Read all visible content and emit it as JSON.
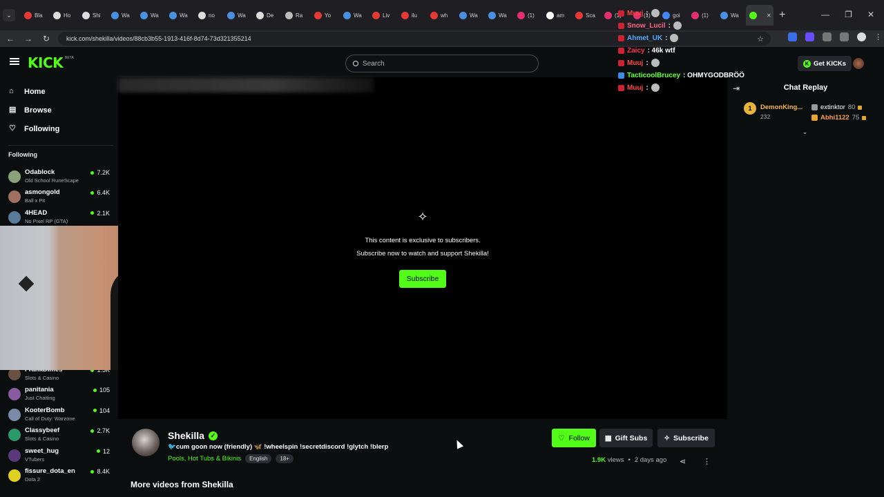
{
  "browser": {
    "tabs": [
      {
        "label": "Bla",
        "color": "#e53935"
      },
      {
        "label": "Ho",
        "color": "#dddddd"
      },
      {
        "label": "Shi",
        "color": "#dddddd"
      },
      {
        "label": "Wa",
        "color": "#4a90e2"
      },
      {
        "label": "Wa",
        "color": "#4a90e2"
      },
      {
        "label": "Wa",
        "color": "#4a90e2"
      },
      {
        "label": "no",
        "color": "#dddddd"
      },
      {
        "label": "Wa",
        "color": "#4a90e2"
      },
      {
        "label": "De",
        "color": "#dddddd"
      },
      {
        "label": "Ra",
        "color": "#bbbbbb"
      },
      {
        "label": "Yo",
        "color": "#e53935"
      },
      {
        "label": "Wa",
        "color": "#4a90e2"
      },
      {
        "label": "Liv",
        "color": "#e53935"
      },
      {
        "label": "ilu",
        "color": "#e53935"
      },
      {
        "label": "wh",
        "color": "#e53935"
      },
      {
        "label": "Wa",
        "color": "#4a90e2"
      },
      {
        "label": "Wa",
        "color": "#4a90e2"
      },
      {
        "label": "(1)",
        "color": "#e1306c"
      },
      {
        "label": "am",
        "color": "#ffffff"
      },
      {
        "label": "Sca",
        "color": "#e53935"
      },
      {
        "label": "(1)",
        "color": "#e1306c"
      },
      {
        "label": "(1)",
        "color": "#e1306c"
      },
      {
        "label": "goi",
        "color": "#4285f4"
      },
      {
        "label": "(1)",
        "color": "#e1306c"
      },
      {
        "label": "Wa",
        "color": "#4a90e2"
      },
      {
        "label": "",
        "color": "#53fc18",
        "active": true
      }
    ],
    "url": "kick.com/shekilla/videos/88cb3b55-1913-416f-8d74-73d321355214"
  },
  "header": {
    "logo": "KICK",
    "beta": "BETA",
    "search_placeholder": "Search",
    "get_kicks": "Get KICKs"
  },
  "sidebar": {
    "nav": [
      {
        "label": "Home",
        "icon": "home-icon"
      },
      {
        "label": "Browse",
        "icon": "browse-icon"
      },
      {
        "label": "Following",
        "icon": "heart-icon"
      }
    ],
    "following_heading": "Following",
    "channels_top": [
      {
        "name": "Odablock",
        "game": "Old School RuneScape",
        "viewers": "7.2K",
        "color": "#8aa27a"
      },
      {
        "name": "asmongold",
        "game": "Ball x Pit",
        "viewers": "6.4K",
        "color": "#a07060"
      },
      {
        "name": "4HEAD",
        "game": "No Pixel RP (GTA)",
        "viewers": "2.1K",
        "color": "#5a7a9a"
      }
    ],
    "channels_bottom": [
      {
        "name": "FrankDimes",
        "game": "Slots & Casino",
        "viewers": "1.5K",
        "color": "#6a5040"
      },
      {
        "name": "panitania",
        "game": "Just Chatting",
        "viewers": "105",
        "color": "#8a5aa0"
      },
      {
        "name": "KooterBomb",
        "game": "Call of Duty: Warzone",
        "viewers": "104",
        "color": "#7a8aa8"
      },
      {
        "name": "Classybeef",
        "game": "Slots & Casino",
        "viewers": "2.7K",
        "color": "#2a9a6a"
      },
      {
        "name": "sweet_hug",
        "game": "VTubers",
        "viewers": "12",
        "color": "#5a3a7a"
      },
      {
        "name": "fissure_dota_en",
        "game": "Dota 2",
        "viewers": "8.4K",
        "color": "#e0d020"
      }
    ]
  },
  "player": {
    "exclusive_line1": "This content is exclusive to subscribers.",
    "exclusive_line2": "Subscribe now to watch and support Shekilla!",
    "subscribe_label": "Subscribe"
  },
  "chat": {
    "title": "Chat Replay",
    "leaderboard": {
      "rank": "1",
      "top_name": "DemonKing...",
      "top_value": "232",
      "others": [
        {
          "name": "extinktor",
          "value": "80",
          "color": "#ffffff"
        },
        {
          "name": "Abhi1122",
          "value": "75",
          "color": "#ffa040"
        }
      ]
    },
    "overlay_messages": [
      {
        "user": "Muuj",
        "text": ":",
        "color": "#ff4444"
      },
      {
        "user": "Snow_Lucil",
        "text": ":",
        "color": "#ff6688"
      },
      {
        "user": "Ahmet_UK",
        "text": ":",
        "color": "#55aaff"
      },
      {
        "user": "Zaicy",
        "text": ": 46k wtf",
        "color": "#ff3355"
      },
      {
        "user": "Muuj",
        "text": ":",
        "color": "#ff4444"
      },
      {
        "user": "TacticoolBrucey",
        "text": ": OHMYGODBRÖÖ",
        "color": "#66ff33"
      },
      {
        "user": "Muuj",
        "text": ":",
        "color": "#ff4444"
      }
    ]
  },
  "video_info": {
    "channel_name": "Shekilla",
    "title": "🐦cum goon now (friendly) 🦋 !wheelspin !secretdiscord !glytch !blerp",
    "category": "Pools, Hot Tubs & Bikinis",
    "tags": [
      "English",
      "18+"
    ],
    "follow_label": "Follow",
    "gift_label": "Gift Subs",
    "subscribe_label": "Subscribe",
    "views": "1.9K",
    "views_suffix": "views",
    "posted": "2 days ago",
    "more_videos": "More videos from Shekilla"
  }
}
